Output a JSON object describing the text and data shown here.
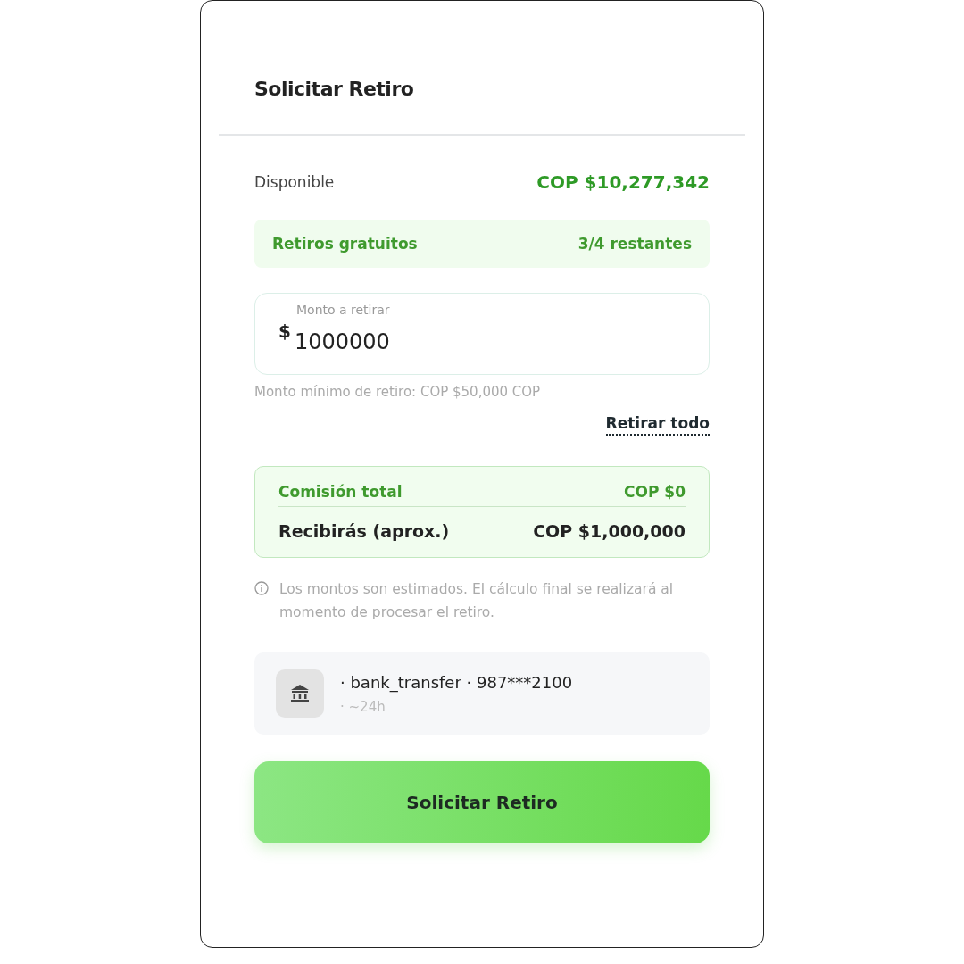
{
  "title": "Solicitar Retiro",
  "available": {
    "label": "Disponible",
    "value": "COP $10,277,342"
  },
  "free_withdrawals": {
    "label": "Retiros gratuitos",
    "value": "3/4 restantes"
  },
  "amount_field": {
    "label": "Monto a retirar",
    "currency": "$",
    "value": "1000000"
  },
  "minimum_note": "Monto mínimo de retiro: COP $50,000 COP",
  "withdraw_all_link": "Retirar todo",
  "summary": [
    {
      "label": "Comisión total",
      "value": "COP $0",
      "kind": "fee"
    },
    {
      "label": "Recibirás (aprox.)",
      "value": "COP $1,000,000",
      "kind": "total"
    }
  ],
  "info_note": "Los montos son estimados. El cálculo final se realizará al momento de procesar el retiro.",
  "method": {
    "title": "· bank_transfer · 987***2100",
    "subtitle": "· ~24h"
  },
  "submit_button": "Solicitar Retiro"
}
